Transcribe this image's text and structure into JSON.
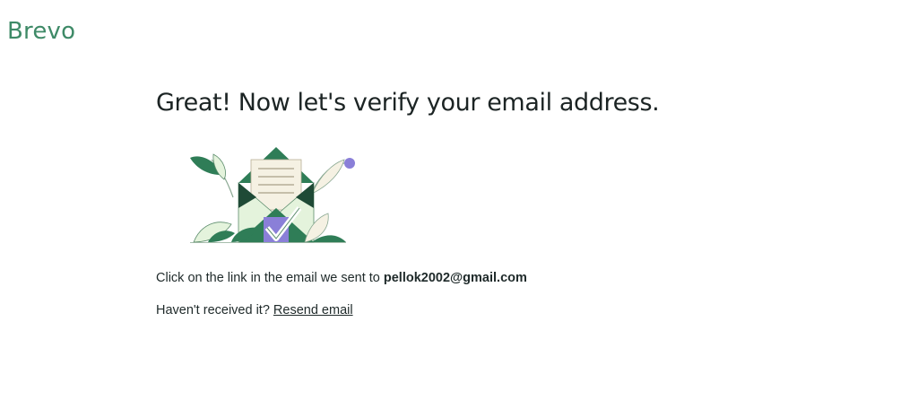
{
  "brand": {
    "logo_text": "Brevo",
    "color": "#3e8a67"
  },
  "main": {
    "headline": "Great! Now let's verify your email address.",
    "illustration_icon": "envelope-with-checkmark-illustration",
    "instruction_prefix": "Click on the link in the email we sent to",
    "email": "pellok2002@gmail.com",
    "not_received_text": "Haven't received it?",
    "resend_link": "Resend email"
  },
  "colors": {
    "green_dark": "#2f7d57",
    "green_light": "#e4f3dc",
    "cream": "#f5f1e3",
    "purple": "#8a7fd8"
  }
}
